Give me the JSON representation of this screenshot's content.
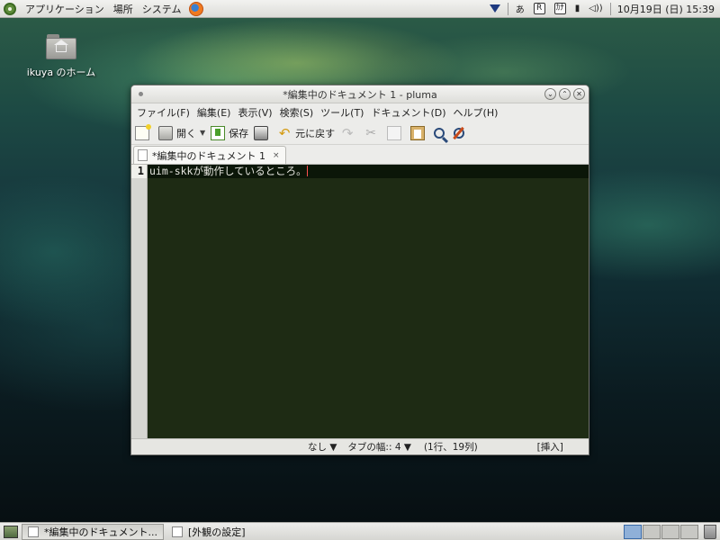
{
  "top_panel": {
    "menus": [
      "アプリケーション",
      "場所",
      "システム"
    ],
    "tray": {
      "ime_mode": "あ",
      "r_label": "R",
      "kana_label": "ｶﾅ",
      "clock": "10月19日 (日) 15:39"
    }
  },
  "desktop": {
    "icons": [
      {
        "label": "ikuya のホーム",
        "icon": "home-folder-icon"
      }
    ]
  },
  "window": {
    "title": "*編集中のドキュメント 1 - pluma",
    "menus": [
      "ファイル(F)",
      "編集(E)",
      "表示(V)",
      "検索(S)",
      "ツール(T)",
      "ドキュメント(D)",
      "ヘルプ(H)"
    ],
    "toolbar": {
      "open_label": "開く",
      "save_label": "保存",
      "undo_label": "元に戻す"
    },
    "tab": {
      "label": "*編集中のドキュメント 1",
      "close": "×"
    },
    "editor": {
      "line_number": "1",
      "text": "uim-skkが動作しているところ。"
    },
    "status": {
      "highlight": "なし ▼",
      "tab_width": "タブの幅:: 4 ▼",
      "position": "(1行、19列)",
      "mode": "[挿入]"
    }
  },
  "bottom_panel": {
    "tasks": [
      {
        "label": "*編集中のドキュメント...",
        "active": true
      },
      {
        "label": "[外観の設定]",
        "active": false
      }
    ]
  },
  "colors": {
    "editor_bg": "#1e2b14",
    "current_line_bg": "#0b1608",
    "caret": "#ff5050",
    "panel_bg": "#e4e4e0"
  }
}
